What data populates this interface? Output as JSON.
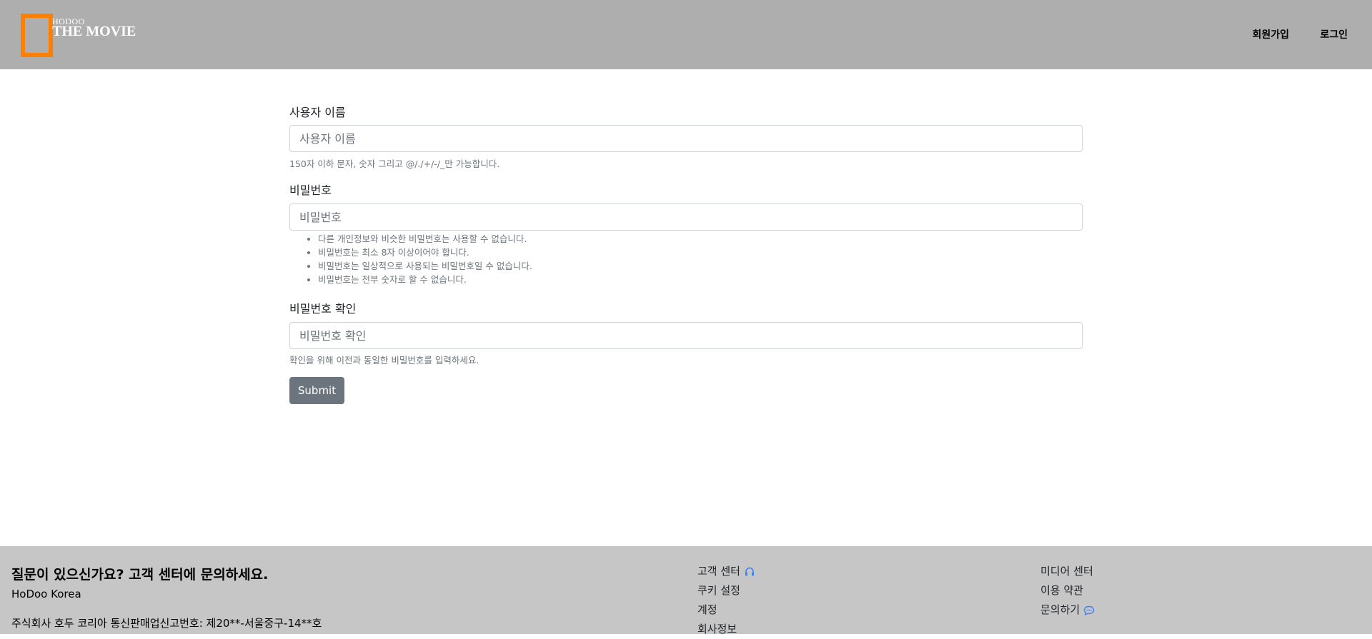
{
  "header": {
    "logo_small": "HODOO",
    "logo_main": "THE MOVIE",
    "nav": {
      "signup": "회원가입",
      "login": "로그인"
    }
  },
  "form": {
    "username": {
      "label": "사용자 이름",
      "placeholder": "사용자 이름",
      "help": "150자 이하 문자, 숫자 그리고 @/./+/-/_만 가능합니다."
    },
    "password": {
      "label": "비밀번호",
      "placeholder": "비밀번호",
      "rules": [
        "다른 개인정보와 비슷한 비밀번호는 사용할 수 없습니다.",
        "비밀번호는 최소 8자 이상이어야 합니다.",
        "비밀번호는 일상적으로 사용되는 비밀번호일 수 없습니다.",
        "비밀번호는 전부 숫자로 할 수 없습니다."
      ]
    },
    "password_confirm": {
      "label": "비밀번호 확인",
      "placeholder": "비밀번호 확인",
      "help": "확인을 위해 이전과 동일한 비밀번호를 입력하세요."
    },
    "submit_label": "Submit"
  },
  "footer": {
    "title": "질문이 있으신가요? 고객 센터에 문의하세요.",
    "company": "HoDoo Korea",
    "registration": "주식회사 호두 코리아 통신판매업신고번호: 제20**-서울중구-14**호",
    "col1": [
      {
        "label": "고객 센터",
        "icon": "headset-icon"
      },
      {
        "label": "쿠키 설정"
      },
      {
        "label": "계정"
      },
      {
        "label": "회사정보"
      }
    ],
    "col2": [
      {
        "label": "미디어 센터"
      },
      {
        "label": "이용 약관"
      },
      {
        "label": "문의하기",
        "icon": "chat-bubble-icon"
      }
    ],
    "icon_color": "#3b82f6"
  }
}
